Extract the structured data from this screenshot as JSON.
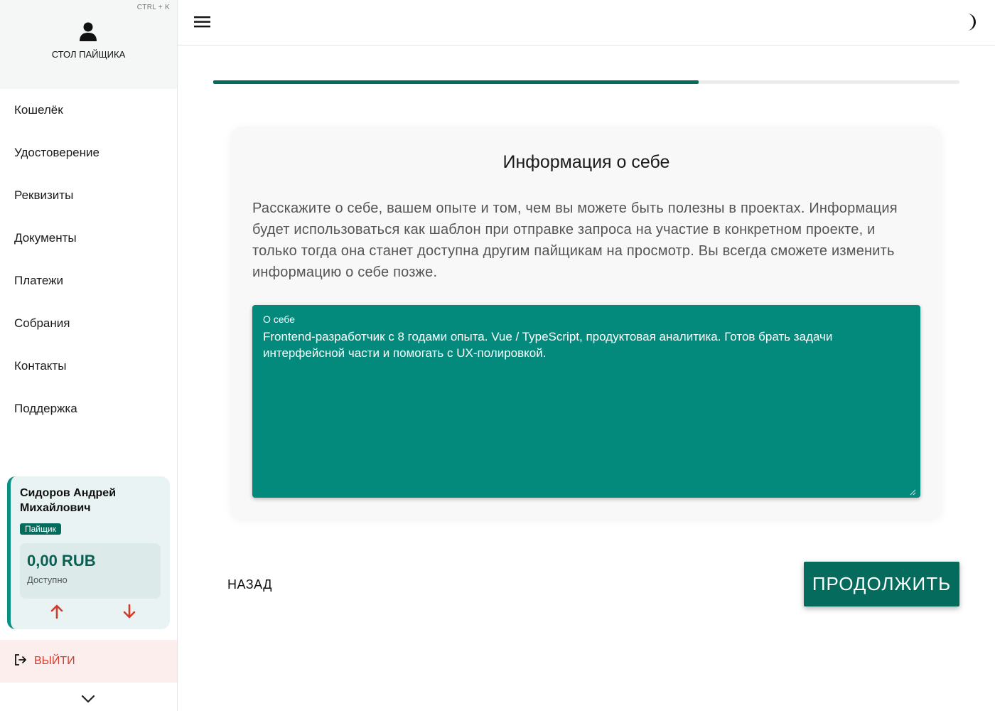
{
  "sidebar": {
    "shortcut": "CTRL + K",
    "brand": "СТОЛ ПАЙЩИКА",
    "items": [
      {
        "label": "Кошелёк"
      },
      {
        "label": "Удостоверение"
      },
      {
        "label": "Реквизиты"
      },
      {
        "label": "Документы"
      },
      {
        "label": "Платежи"
      },
      {
        "label": "Собрания"
      },
      {
        "label": "Контакты"
      },
      {
        "label": "Поддержка"
      }
    ],
    "user": {
      "name": "Сидоров Андрей Михайлович",
      "role": "Пайщик",
      "balance": "0,00 RUB",
      "balance_label": "Доступно"
    },
    "logout_label": "ВЫЙТИ"
  },
  "progress": {
    "fraction": 0.65
  },
  "form": {
    "title": "Информация о себе",
    "description": "Расскажите о себе, вашем опыте и том, чем вы можете быть полезны в проектах. Информация будет использоваться как шаблон при отправке запроса на участие в конкретном проекте, и только тогда она станет доступна другим пайщикам на просмотр. Вы всегда сможете изменить информацию о себе позже.",
    "field_label": "О себе",
    "field_value": "Frontend-разработчик с 8 годами опыта. Vue / TypeScript, продуктовая аналитика. Готов брать задачи интерфейсной части и помогать с UX-полировкой."
  },
  "actions": {
    "back_label": "НАЗАД",
    "next_label": "ПРОДОЛЖИТЬ"
  },
  "colors": {
    "accent": "#056b5c",
    "field_bg": "#038a7d",
    "danger": "#d33b2c"
  }
}
